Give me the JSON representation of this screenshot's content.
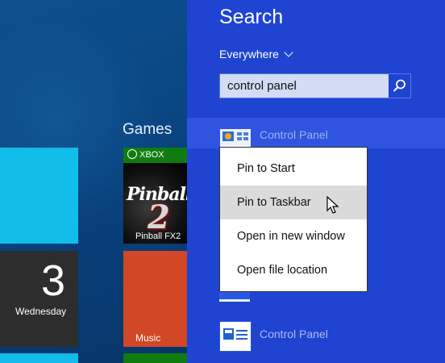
{
  "start_screen": {
    "group_label": "Games",
    "calendar": {
      "day_number": "3",
      "weekday": "Wednesday"
    },
    "pinball": {
      "badge": "XBOX",
      "logo_text": "Pinball",
      "logo_num": "2",
      "label": "Pinball FX2"
    },
    "music": {
      "label": "Music"
    }
  },
  "search": {
    "title": "Search",
    "scope": "Everywhere",
    "query": "control panel",
    "results": [
      {
        "label": "Control Panel"
      },
      {
        "label": "Control Panel"
      }
    ]
  },
  "context_menu": {
    "items": [
      {
        "label": "Pin to Start"
      },
      {
        "label": "Pin to Taskbar"
      },
      {
        "label": "Open in new window"
      },
      {
        "label": "Open file location"
      }
    ],
    "highlighted_index": 1
  },
  "colors": {
    "search_pane": "#1f44d2",
    "cyan_tile": "#11bde9",
    "music_tile": "#d24726",
    "xbox_green": "#107c10"
  }
}
